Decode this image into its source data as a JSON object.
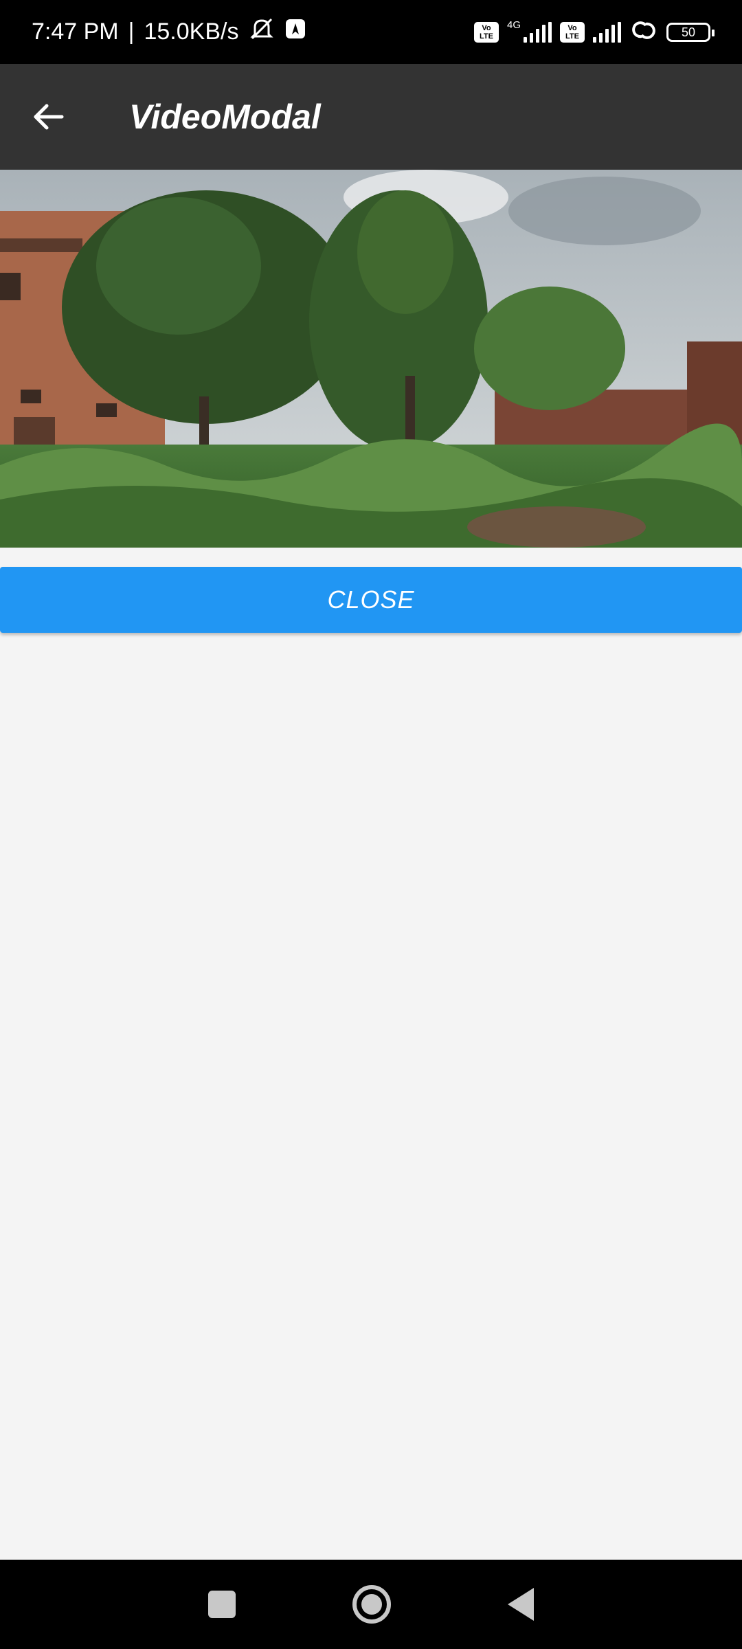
{
  "status_bar": {
    "time": "7:47 PM",
    "separator": "|",
    "net_speed": "15.0KB/s",
    "volte1": "Vo\nLTE",
    "net_type": "4G",
    "volte2": "Vo\nLTE",
    "battery": "50"
  },
  "app_bar": {
    "title": "VideoModal"
  },
  "video": {
    "scene": "outdoor-trees-and-grass"
  },
  "actions": {
    "close_label": "CLOSE"
  },
  "colors": {
    "app_bar": "#333333",
    "button": "#2196f3",
    "background": "#f4f4f4"
  }
}
